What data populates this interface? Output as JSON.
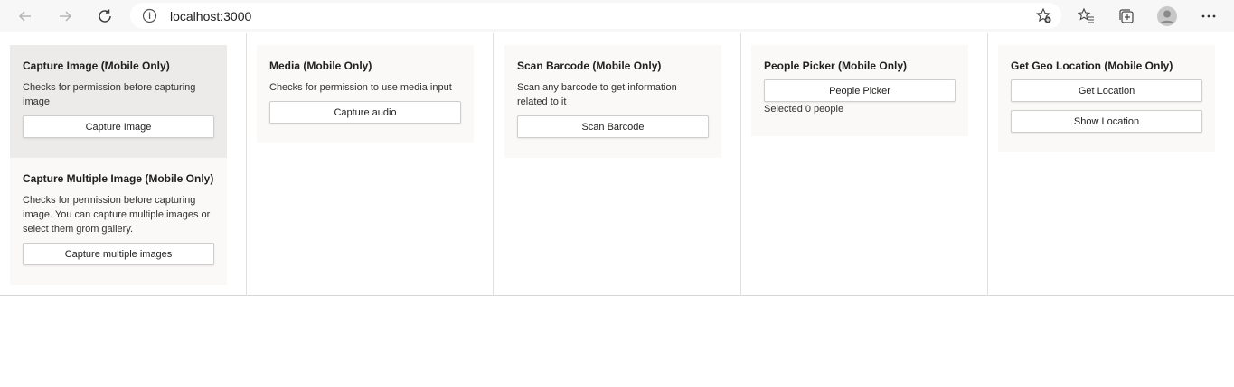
{
  "browser": {
    "url": "localhost:3000",
    "icons": [
      "back-arrow-icon",
      "forward-arrow-icon",
      "refresh-icon",
      "site-info-icon",
      "add-favorite-icon",
      "favorites-icon",
      "collections-icon",
      "profile-avatar-icon",
      "more-options-icon"
    ]
  },
  "cards": {
    "capture_image": {
      "title": "Capture Image (Mobile Only)",
      "description": "Checks for permission before capturing image",
      "button": "Capture Image"
    },
    "capture_multiple": {
      "title": "Capture Multiple Image (Mobile Only)",
      "description": "Checks for permission before capturing image. You can capture multiple images or select them grom gallery.",
      "button": "Capture multiple images"
    },
    "media": {
      "title": "Media (Mobile Only)",
      "description": "Checks for permission to use media input",
      "button": "Capture audio"
    },
    "scan_barcode": {
      "title": "Scan Barcode (Mobile Only)",
      "description": "Scan any barcode to get information related to it",
      "button": "Scan Barcode"
    },
    "people_picker": {
      "title": "People Picker (Mobile Only)",
      "button": "People Picker",
      "status": "Selected 0 people"
    },
    "geo_location": {
      "title": "Get Geo Location (Mobile Only)",
      "button_get": "Get Location",
      "button_show": "Show Location"
    }
  },
  "colors": {
    "card_bg": "#faf9f8",
    "card_hover_bg": "#edebe9",
    "toolbar_bg": "#f7f7f7",
    "text": "#201f1e"
  }
}
